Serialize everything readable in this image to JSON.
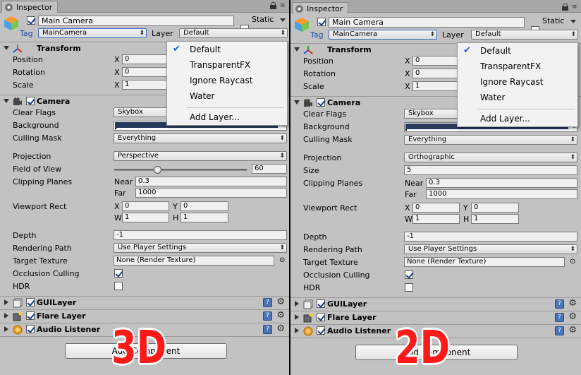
{
  "panels": [
    {
      "id": "3d",
      "tab_label": "Inspector",
      "object_name": "Main Camera",
      "static_label": "Static",
      "tag_label": "Tag",
      "tag_value": "MainCamera",
      "layer_label": "Layer",
      "layer_value": "Default",
      "layer_menu": {
        "items": [
          "Default",
          "TransparentFX",
          "Ignore Raycast",
          "Water"
        ],
        "selected": "Default",
        "add_layer": "Add Layer..."
      },
      "transform": {
        "title": "Transform",
        "position_label": "Position",
        "rotation_label": "Rotation",
        "scale_label": "Scale",
        "x_label": "X",
        "position_x": "0",
        "rotation_x": "0",
        "scale_x": "1"
      },
      "camera": {
        "title": "Camera",
        "clear_flags_label": "Clear Flags",
        "clear_flags_value": "Skybox",
        "background_label": "Background",
        "background_color": "#273a5c",
        "culling_mask_label": "Culling Mask",
        "culling_mask_value": "Everything",
        "projection_label": "Projection",
        "projection_value": "Perspective",
        "param_label": "Field of View",
        "param_value": "60",
        "fov_slider_fraction": 0.33,
        "clipping_label": "Clipping Planes",
        "near_label": "Near",
        "near_value": "0.3",
        "far_label": "Far",
        "far_value": "1000",
        "viewport_label": "Viewport Rect",
        "x_label": "X",
        "x_value": "0",
        "y_label": "Y",
        "y_value": "0",
        "w_label": "W",
        "w_value": "1",
        "h_label": "H",
        "h_value": "1",
        "depth_label": "Depth",
        "depth_value": "-1",
        "rendering_path_label": "Rendering Path",
        "rendering_path_value": "Use Player Settings",
        "target_texture_label": "Target Texture",
        "target_texture_value": "None (Render Texture)",
        "occlusion_label": "Occlusion Culling",
        "hdr_label": "HDR"
      },
      "components": [
        "GUILayer",
        "Flare Layer",
        "Audio Listener"
      ],
      "add_component_label": "Add Component",
      "overlay_label": "3D"
    },
    {
      "id": "2d",
      "tab_label": "Inspector",
      "object_name": "Main Camera",
      "static_label": "Static",
      "tag_label": "Tag",
      "tag_value": "MainCamera",
      "layer_label": "Layer",
      "layer_value": "Default",
      "layer_menu": {
        "items": [
          "Default",
          "TransparentFX",
          "Ignore Raycast",
          "Water"
        ],
        "selected": "Default",
        "add_layer": "Add Layer..."
      },
      "transform": {
        "title": "Transform",
        "position_label": "Position",
        "rotation_label": "Rotation",
        "scale_label": "Scale",
        "x_label": "X",
        "position_x": "0",
        "rotation_x": "0",
        "scale_x": "1"
      },
      "camera": {
        "title": "Camera",
        "clear_flags_label": "Clear Flags",
        "clear_flags_value": "Skybox",
        "background_label": "Background",
        "background_color": "#273a5c",
        "culling_mask_label": "Culling Mask",
        "culling_mask_value": "Everything",
        "projection_label": "Projection",
        "projection_value": "Orthographic",
        "param_label": "Size",
        "param_value": "5",
        "clipping_label": "Clipping Planes",
        "near_label": "Near",
        "near_value": "0.3",
        "far_label": "Far",
        "far_value": "1000",
        "viewport_label": "Viewport Rect",
        "x_label": "X",
        "x_value": "0",
        "y_label": "Y",
        "y_value": "0",
        "w_label": "W",
        "w_value": "1",
        "h_label": "H",
        "h_value": "1",
        "depth_label": "Depth",
        "depth_value": "-1",
        "rendering_path_label": "Rendering Path",
        "rendering_path_value": "Use Player Settings",
        "target_texture_label": "Target Texture",
        "target_texture_value": "None (Render Texture)",
        "occlusion_label": "Occlusion Culling",
        "hdr_label": "HDR"
      },
      "components": [
        "GUILayer",
        "Flare Layer",
        "Audio Listener"
      ],
      "add_component_label": "Add Component",
      "overlay_label": "2D"
    }
  ]
}
